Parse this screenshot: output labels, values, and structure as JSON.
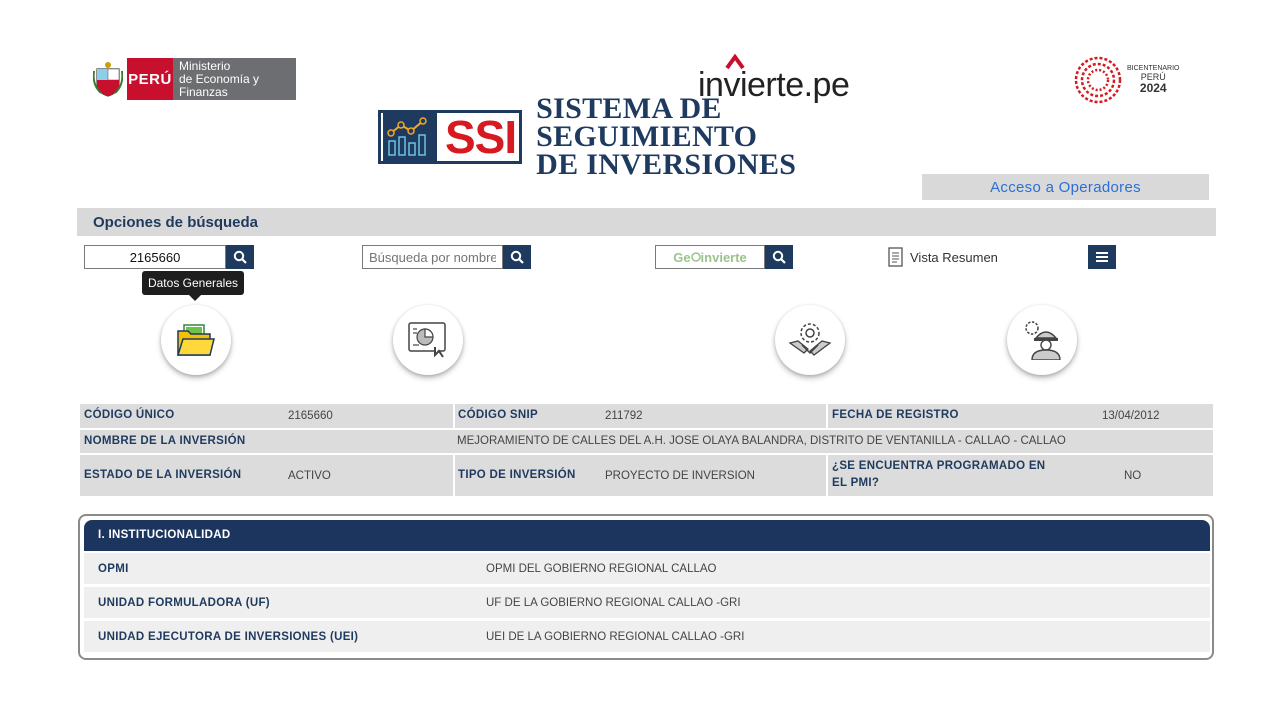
{
  "header": {
    "mef": {
      "peru": "PERÚ",
      "line1": "Ministerio",
      "line2": "de Economía y Finanzas"
    },
    "invierte": {
      "a": "in",
      "b": "vierte",
      "c": ".pe"
    },
    "bicentenario": {
      "line1": "BICENTENARIO",
      "line2": "PERÚ",
      "year": "2024"
    },
    "ssi": {
      "short": "SSI",
      "line1": "SISTEMA DE SEGUIMIENTO",
      "line2": "DE INVERSIONES"
    },
    "acceso_label": "Acceso a Operadores"
  },
  "search": {
    "title": "Opciones de búsqueda",
    "code_value": "2165660",
    "name_placeholder": "Búsqueda por nombre",
    "geo_label_a": "Ge",
    "geo_label_b": "invierte",
    "vista_resumen": "Vista Resumen"
  },
  "tooltip": "Datos Generales",
  "actions": [
    {
      "icon": "folder-icon"
    },
    {
      "icon": "report-chart-icon"
    },
    {
      "icon": "handshake-icon"
    },
    {
      "icon": "engineer-icon"
    }
  ],
  "info": {
    "codigo_unico_label": "CÓDIGO ÚNICO",
    "codigo_unico": "2165660",
    "codigo_snip_label": "CÓDIGO SNIP",
    "codigo_snip": "211792",
    "fecha_registro_label": "FECHA DE REGISTRO",
    "fecha_registro": "13/04/2012",
    "nombre_label": "NOMBRE DE LA INVERSIÓN",
    "nombre": "MEJORAMIENTO DE CALLES DEL A.H. JOSE OLAYA BALANDRA, DISTRITO DE VENTANILLA - CALLAO - CALLAO",
    "estado_label": "ESTADO DE LA INVERSIÓN",
    "estado": "ACTIVO",
    "tipo_label": "TIPO DE INVERSIÓN",
    "tipo": "PROYECTO DE INVERSION",
    "pmi_label_1": "¿SE ENCUENTRA PROGRAMADO EN",
    "pmi_label_2": "EL PMI?",
    "pmi": "NO"
  },
  "institucionalidad": {
    "title": "I. INSTITUCIONALIDAD",
    "rows": [
      {
        "label": "OPMI",
        "value": "OPMI DEL GOBIERNO REGIONAL CALLAO"
      },
      {
        "label": "UNIDAD FORMULADORA (UF)",
        "value": "UF DE LA GOBIERNO REGIONAL CALLAO -GRI"
      },
      {
        "label": "UNIDAD EJECUTORA DE INVERSIONES (UEI)",
        "value": "UEI DE LA GOBIERNO REGIONAL CALLAO -GRI"
      }
    ]
  },
  "colors": {
    "navy": "#1f3a5f",
    "red": "#d71920",
    "link": "#2c6fd6",
    "panel_gray": "#dcdcdc"
  }
}
